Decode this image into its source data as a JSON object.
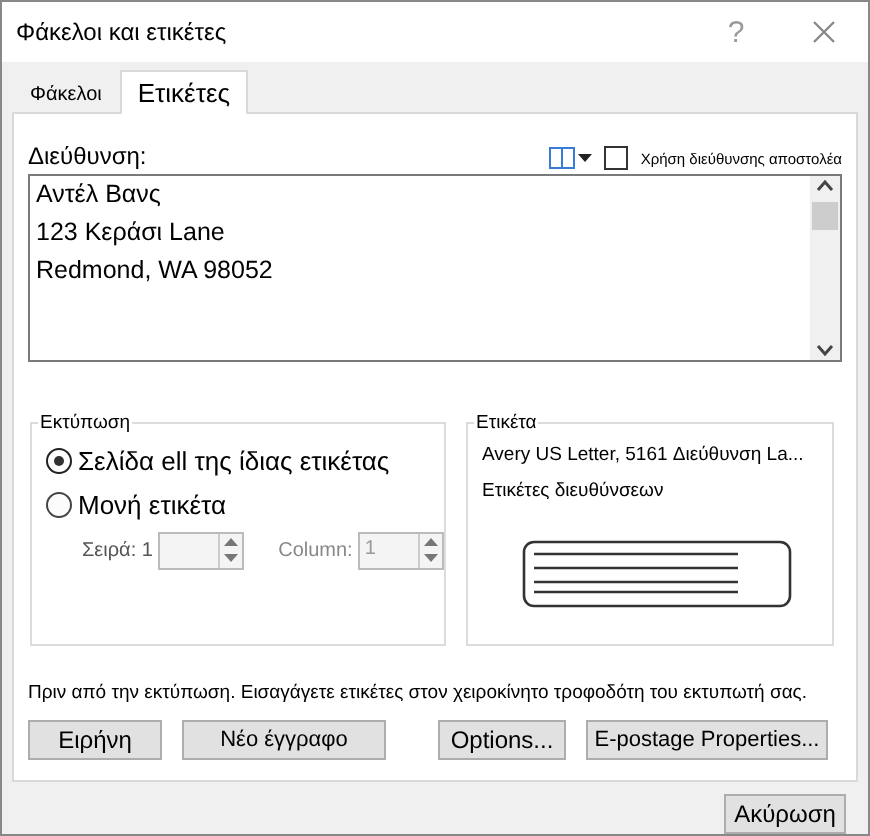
{
  "window": {
    "title": "Φάκελοι και ετικέτες",
    "help": "?"
  },
  "tabs": [
    {
      "label": "Φάκελοι",
      "selected": false
    },
    {
      "label": "Ετικέτες",
      "selected": true
    }
  ],
  "address": {
    "label": "Διεύθυνση:",
    "value": "Αντέλ Βανς\n123 Κεράσι Lane\nRedmond, WA 98052",
    "use_return_address": {
      "label": "Χρήση διεύθυνσης αποστολέα",
      "checked": false
    }
  },
  "print": {
    "title": "Εκτύπωση",
    "options": [
      {
        "label": "Σελίδα ell της ίδιας ετικέτας",
        "selected": true
      },
      {
        "label": "Μονή ετικέτα",
        "selected": false
      }
    ],
    "row": {
      "label": "Σειρά: 1",
      "disabled": true
    },
    "column": {
      "label": "Column:",
      "value": "1",
      "disabled": true
    }
  },
  "label": {
    "title": "Ετικέτα",
    "lines": [
      "Avery US Letter, 5161 Διεύθυνση La...",
      "Ετικέτες διευθύνσεων"
    ]
  },
  "note": "Πριν από την εκτύπωση. Εισαγάγετε ετικέτες στον χειροκίνητο τροφοδότη του εκτυπωτή σας.",
  "buttons": [
    {
      "label": "Ειρήνη"
    },
    {
      "label": "Νέο έγγραφο"
    },
    {
      "label": "Options..."
    },
    {
      "label": "E-postage Properties..."
    }
  ],
  "cancel": "Ακύρωση"
}
